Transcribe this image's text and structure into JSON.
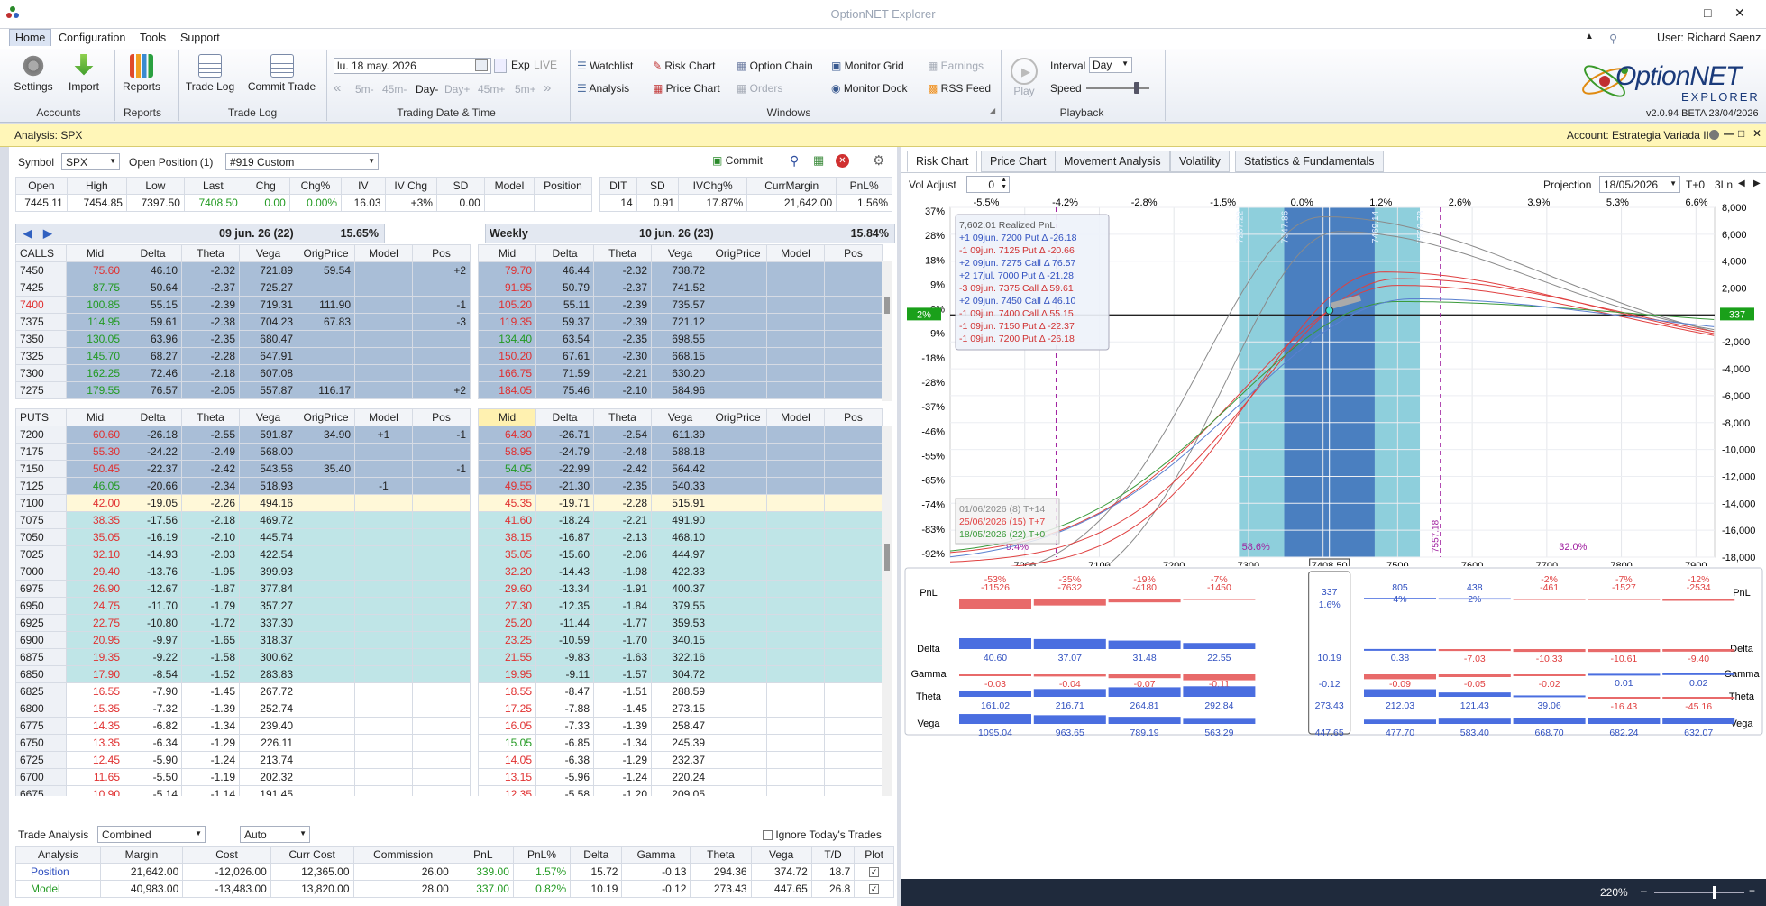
{
  "app": {
    "title": "OptionNET Explorer",
    "user": "User: Richard Saenz",
    "version": "v2.0.94 BETA 23/04/2026",
    "logo": "OptionNET",
    "logo_sub": "EXPLORER"
  },
  "menu": [
    "Home",
    "Configuration",
    "Tools",
    "Support"
  ],
  "ribbon": {
    "settings": "Settings",
    "import": "Import",
    "accounts": "Accounts",
    "reports": "Reports",
    "reports_grp": "Reports",
    "trade_log": "Trade Log",
    "commit_trade": "Commit Trade",
    "trade_log_grp": "Trade Log",
    "date": "lu. 18 may. 2026",
    "exp": "Exp",
    "live": "LIVE",
    "steps": [
      "5m-",
      "45m-",
      "Day-",
      "Day+",
      "45m+",
      "5m+"
    ],
    "tdt_grp": "Trading Date & Time",
    "watchlist": "Watchlist",
    "analysis": "Analysis",
    "risk_chart": "Risk Chart",
    "price_chart": "Price Chart",
    "option_chain": "Option Chain",
    "orders": "Orders",
    "monitor_grid": "Monitor Grid",
    "monitor_dock": "Monitor Dock",
    "earnings": "Earnings",
    "rss": "RSS Feed",
    "windows_grp": "Windows",
    "play": "Play",
    "interval_lbl": "Interval",
    "interval": "Day",
    "speed": "Speed",
    "playback_grp": "Playback"
  },
  "analysis": {
    "title": "Analysis: SPX",
    "account": "Account: Estrategia Variada II"
  },
  "symbol": {
    "label": "Symbol",
    "value": "SPX",
    "open_pos": "Open Position (1)",
    "pos_value": "#919 Custom",
    "commit": "Commit"
  },
  "quote": {
    "headers": [
      "Open",
      "High",
      "Low",
      "Last",
      "Chg",
      "Chg%",
      "IV",
      "IV Chg",
      "SD",
      "Model",
      "Position"
    ],
    "values": [
      "7445.11",
      "7454.85",
      "7397.50",
      "7408.50",
      "0.00",
      "0.00%",
      "16.03",
      "+3%",
      "0.00",
      "",
      ""
    ]
  },
  "summary": {
    "headers": [
      "DIT",
      "SD",
      "IVChg%",
      "CurrMargin",
      "PnL%"
    ],
    "values": [
      "14",
      "0.91",
      "17.87%",
      "21,642.00",
      "1.56%"
    ]
  },
  "exp1": {
    "label": "09 jun. 26 (22)",
    "iv": "15.65%"
  },
  "exp2": {
    "label": "10 jun. 26 (23)",
    "iv": "15.84%",
    "name": "Weekly"
  },
  "cols_left": [
    "Mid",
    "Delta",
    "Theta",
    "Vega",
    "OrigPrice",
    "Model",
    "Pos"
  ],
  "cols_right": [
    "Mid",
    "Delta",
    "Theta",
    "Vega",
    "OrigPrice",
    "Model",
    "Pos"
  ],
  "calls_label": "CALLS",
  "puts_label": "PUTS",
  "calls": [
    [
      "7450",
      "75.60",
      "46.10",
      "-2.32",
      "721.89",
      "59.54",
      "",
      "+2",
      "79.70",
      "46.44",
      "-2.32",
      "738.72",
      "",
      "",
      ""
    ],
    [
      "7425",
      "87.75",
      "50.64",
      "-2.37",
      "725.27",
      "",
      "",
      "",
      "91.95",
      "50.79",
      "-2.37",
      "741.52",
      "",
      "",
      ""
    ],
    [
      "7400",
      "100.85",
      "55.15",
      "-2.39",
      "719.31",
      "111.90",
      "",
      "-1",
      "105.20",
      "55.11",
      "-2.39",
      "735.57",
      "",
      "",
      ""
    ],
    [
      "7375",
      "114.95",
      "59.61",
      "-2.38",
      "704.23",
      "67.83",
      "",
      "-3",
      "119.35",
      "59.37",
      "-2.39",
      "721.12",
      "",
      "",
      ""
    ],
    [
      "7350",
      "130.05",
      "63.96",
      "-2.35",
      "680.47",
      "",
      "",
      "",
      "134.40",
      "63.54",
      "-2.35",
      "698.55",
      "",
      "",
      ""
    ],
    [
      "7325",
      "145.70",
      "68.27",
      "-2.28",
      "647.91",
      "",
      "",
      "",
      "150.20",
      "67.61",
      "-2.30",
      "668.15",
      "",
      "",
      ""
    ],
    [
      "7300",
      "162.25",
      "72.46",
      "-2.18",
      "607.08",
      "",
      "",
      "",
      "166.75",
      "71.59",
      "-2.21",
      "630.20",
      "",
      "",
      ""
    ],
    [
      "7275",
      "179.55",
      "76.57",
      "-2.05",
      "557.87",
      "116.17",
      "",
      "+2",
      "184.05",
      "75.46",
      "-2.10",
      "584.96",
      "",
      "",
      ""
    ]
  ],
  "puts": [
    [
      "7200",
      "60.60",
      "-26.18",
      "-2.55",
      "591.87",
      "34.90",
      "+1",
      "-1",
      "64.30",
      "-26.71",
      "-2.54",
      "611.39",
      "",
      "",
      ""
    ],
    [
      "7175",
      "55.30",
      "-24.22",
      "-2.49",
      "568.00",
      "",
      "",
      "",
      "58.95",
      "-24.79",
      "-2.48",
      "588.18",
      "",
      "",
      ""
    ],
    [
      "7150",
      "50.45",
      "-22.37",
      "-2.42",
      "543.56",
      "35.40",
      "",
      "-1",
      "54.05",
      "-22.99",
      "-2.42",
      "564.42",
      "",
      "",
      ""
    ],
    [
      "7125",
      "46.05",
      "-20.66",
      "-2.34",
      "518.93",
      "",
      "-1",
      "",
      "49.55",
      "-21.30",
      "-2.35",
      "540.33",
      "",
      "",
      ""
    ],
    [
      "7100",
      "42.00",
      "-19.05",
      "-2.26",
      "494.16",
      "",
      "",
      "",
      "45.35",
      "-19.71",
      "-2.28",
      "515.91",
      "",
      "",
      ""
    ],
    [
      "7075",
      "38.35",
      "-17.56",
      "-2.18",
      "469.72",
      "",
      "",
      "",
      "41.60",
      "-18.24",
      "-2.21",
      "491.90",
      "",
      "",
      ""
    ],
    [
      "7050",
      "35.05",
      "-16.19",
      "-2.10",
      "445.74",
      "",
      "",
      "",
      "38.15",
      "-16.87",
      "-2.13",
      "468.10",
      "",
      "",
      ""
    ],
    [
      "7025",
      "32.10",
      "-14.93",
      "-2.03",
      "422.54",
      "",
      "",
      "",
      "35.05",
      "-15.60",
      "-2.06",
      "444.97",
      "",
      "",
      ""
    ],
    [
      "7000",
      "29.40",
      "-13.76",
      "-1.95",
      "399.93",
      "",
      "",
      "",
      "32.20",
      "-14.43",
      "-1.98",
      "422.33",
      "",
      "",
      ""
    ],
    [
      "6975",
      "26.90",
      "-12.67",
      "-1.87",
      "377.84",
      "",
      "",
      "",
      "29.60",
      "-13.34",
      "-1.91",
      "400.37",
      "",
      "",
      ""
    ],
    [
      "6950",
      "24.75",
      "-11.70",
      "-1.79",
      "357.27",
      "",
      "",
      "",
      "27.30",
      "-12.35",
      "-1.84",
      "379.55",
      "",
      "",
      ""
    ],
    [
      "6925",
      "22.75",
      "-10.80",
      "-1.72",
      "337.30",
      "",
      "",
      "",
      "25.20",
      "-11.44",
      "-1.77",
      "359.53",
      "",
      "",
      ""
    ],
    [
      "6900",
      "20.95",
      "-9.97",
      "-1.65",
      "318.37",
      "",
      "",
      "",
      "23.25",
      "-10.59",
      "-1.70",
      "340.15",
      "",
      "",
      ""
    ],
    [
      "6875",
      "19.35",
      "-9.22",
      "-1.58",
      "300.62",
      "",
      "",
      "",
      "21.55",
      "-9.83",
      "-1.63",
      "322.16",
      "",
      "",
      ""
    ],
    [
      "6850",
      "17.90",
      "-8.54",
      "-1.52",
      "283.83",
      "",
      "",
      "",
      "19.95",
      "-9.11",
      "-1.57",
      "304.72",
      "",
      "",
      ""
    ],
    [
      "6825",
      "16.55",
      "-7.90",
      "-1.45",
      "267.72",
      "",
      "",
      "",
      "18.55",
      "-8.47",
      "-1.51",
      "288.59",
      "",
      "",
      ""
    ],
    [
      "6800",
      "15.35",
      "-7.32",
      "-1.39",
      "252.74",
      "",
      "",
      "",
      "17.25",
      "-7.88",
      "-1.45",
      "273.15",
      "",
      "",
      ""
    ],
    [
      "6775",
      "14.35",
      "-6.82",
      "-1.34",
      "239.40",
      "",
      "",
      "",
      "16.05",
      "-7.33",
      "-1.39",
      "258.47",
      "",
      "",
      ""
    ],
    [
      "6750",
      "13.35",
      "-6.34",
      "-1.29",
      "226.11",
      "",
      "",
      "",
      "15.05",
      "-6.85",
      "-1.34",
      "245.39",
      "",
      "",
      ""
    ],
    [
      "6725",
      "12.45",
      "-5.90",
      "-1.24",
      "213.74",
      "",
      "",
      "",
      "14.05",
      "-6.38",
      "-1.29",
      "232.37",
      "",
      "",
      ""
    ],
    [
      "6700",
      "11.65",
      "-5.50",
      "-1.19",
      "202.32",
      "",
      "",
      "",
      "13.15",
      "-5.96",
      "-1.24",
      "220.24",
      "",
      "",
      ""
    ],
    [
      "6675",
      "10.90",
      "-5.14",
      "-1.14",
      "191.45",
      "",
      "",
      "",
      "12.35",
      "-5.58",
      "-1.20",
      "209.05",
      "",
      "",
      ""
    ]
  ],
  "trade_analysis": {
    "label": "Trade Analysis",
    "mode": "Combined",
    "auto": "Auto",
    "ignore": "Ignore Today's Trades",
    "headers": [
      "Analysis",
      "Margin",
      "Cost",
      "Curr Cost",
      "Commission",
      "PnL",
      "PnL%",
      "Delta",
      "Gamma",
      "Theta",
      "Vega",
      "T/D",
      "Plot"
    ],
    "rows": [
      [
        "Position",
        "21,642.00",
        "-12,026.00",
        "12,365.00",
        "26.00",
        "339.00",
        "1.57%",
        "15.72",
        "-0.13",
        "294.36",
        "374.72",
        "18.7"
      ],
      [
        "Model",
        "40,983.00",
        "-13,483.00",
        "13,820.00",
        "28.00",
        "337.00",
        "0.82%",
        "10.19",
        "-0.12",
        "273.43",
        "447.65",
        "26.8"
      ]
    ]
  },
  "risk_tabs": [
    "Risk Chart",
    "Price Chart",
    "Movement Analysis",
    "Volatility",
    "Statistics & Fundamentals"
  ],
  "risk": {
    "vol_adjust_label": "Vol Adjust",
    "vol_adjust": "0",
    "projection_label": "Projection",
    "projection": "18/05/2026",
    "tplus": "T+0",
    "ln": "3Ln",
    "zoom": "220%"
  },
  "chart_data": {
    "type": "line",
    "x_ticks": [
      "7000",
      "7100",
      "7200",
      "7300",
      "7400",
      "7500",
      "7600",
      "7700",
      "7800",
      "7900"
    ],
    "x_current": "7408.50",
    "top_pct_ticks": [
      "-5.5%",
      "-4.2%",
      "-2.8%",
      "-1.5%",
      "0.0%",
      "1.2%",
      "2.6%",
      "3.9%",
      "5.3%",
      "6.6%"
    ],
    "left_pct_ticks": [
      "37%",
      "28%",
      "18%",
      "9%",
      "0%",
      "-9%",
      "-18%",
      "-28%",
      "-37%",
      "-46%",
      "-55%",
      "-65%",
      "-74%",
      "-83%",
      "-92%"
    ],
    "right_ticks": [
      "8,000",
      "6,000",
      "4,000",
      "2,000",
      "0",
      "-2,000",
      "-4,000",
      "-6,000",
      "-8,000",
      "-10,000",
      "-12,000",
      "-14,000",
      "-16,000",
      "-18,000"
    ],
    "current_pnl_pct": "2%",
    "current_pnl": "337",
    "sd_labels": [
      "7287.22",
      "7347.86",
      "7469.14",
      "7529.78"
    ],
    "breakeven_label": "7557.18",
    "prob_labels": [
      "9.4%",
      "58.6%",
      "32.0%"
    ],
    "legend_lines": [
      "01/06/2026 (8) T+14",
      "25/06/2026 (15) T+7",
      "18/05/2026 (22) T+0"
    ],
    "tooltip": [
      "7,602.01 Realized PnL",
      "+1 09jun. 7200 Put Δ -26.18",
      "-1 09jun. 7125 Put Δ -20.66",
      "+2 09jun. 7275 Call Δ 76.57",
      "+2 17jul. 7000 Put Δ -21.28",
      "-3 09jun. 7375 Call Δ 59.61",
      "+2 09jun. 7450 Call Δ 46.10",
      "-1 09jun. 7400 Call Δ 55.15",
      "-1 09jun. 7150 Put Δ -22.37",
      "-1 09jun. 7200 Put Δ -26.18"
    ]
  },
  "greeks": {
    "labels": [
      "PnL",
      "Delta",
      "Gamma",
      "Theta",
      "Vega"
    ],
    "pnl_pct": [
      "-53%",
      "-35%",
      "-19%",
      "-7%",
      "",
      "",
      "",
      "-2%",
      "-7%",
      "-12%"
    ],
    "pnl": [
      "-11526",
      "-7632",
      "-4180",
      "-1450",
      "337",
      "805",
      "438",
      "-461",
      "-1527",
      "-2534"
    ],
    "pnl_center_pct": "1.6%",
    "pnl_sub": [
      "",
      "",
      "",
      "",
      "",
      "4%",
      "2%",
      "",
      "",
      ""
    ],
    "delta": [
      "40.60",
      "37.07",
      "31.48",
      "22.55",
      "10.19",
      "0.38",
      "-7.03",
      "-10.33",
      "-10.61",
      "-9.40"
    ],
    "gamma": [
      "-0.03",
      "-0.04",
      "-0.07",
      "-0.11",
      "-0.12",
      "-0.09",
      "-0.05",
      "-0.02",
      "0.01",
      "0.02"
    ],
    "theta": [
      "161.02",
      "216.71",
      "264.81",
      "292.84",
      "273.43",
      "212.03",
      "121.43",
      "39.06",
      "-16.43",
      "-45.16"
    ],
    "vega": [
      "1095.04",
      "963.65",
      "789.19",
      "563.29",
      "447.65",
      "477.70",
      "583.40",
      "668.70",
      "682.24",
      "632.07"
    ]
  }
}
